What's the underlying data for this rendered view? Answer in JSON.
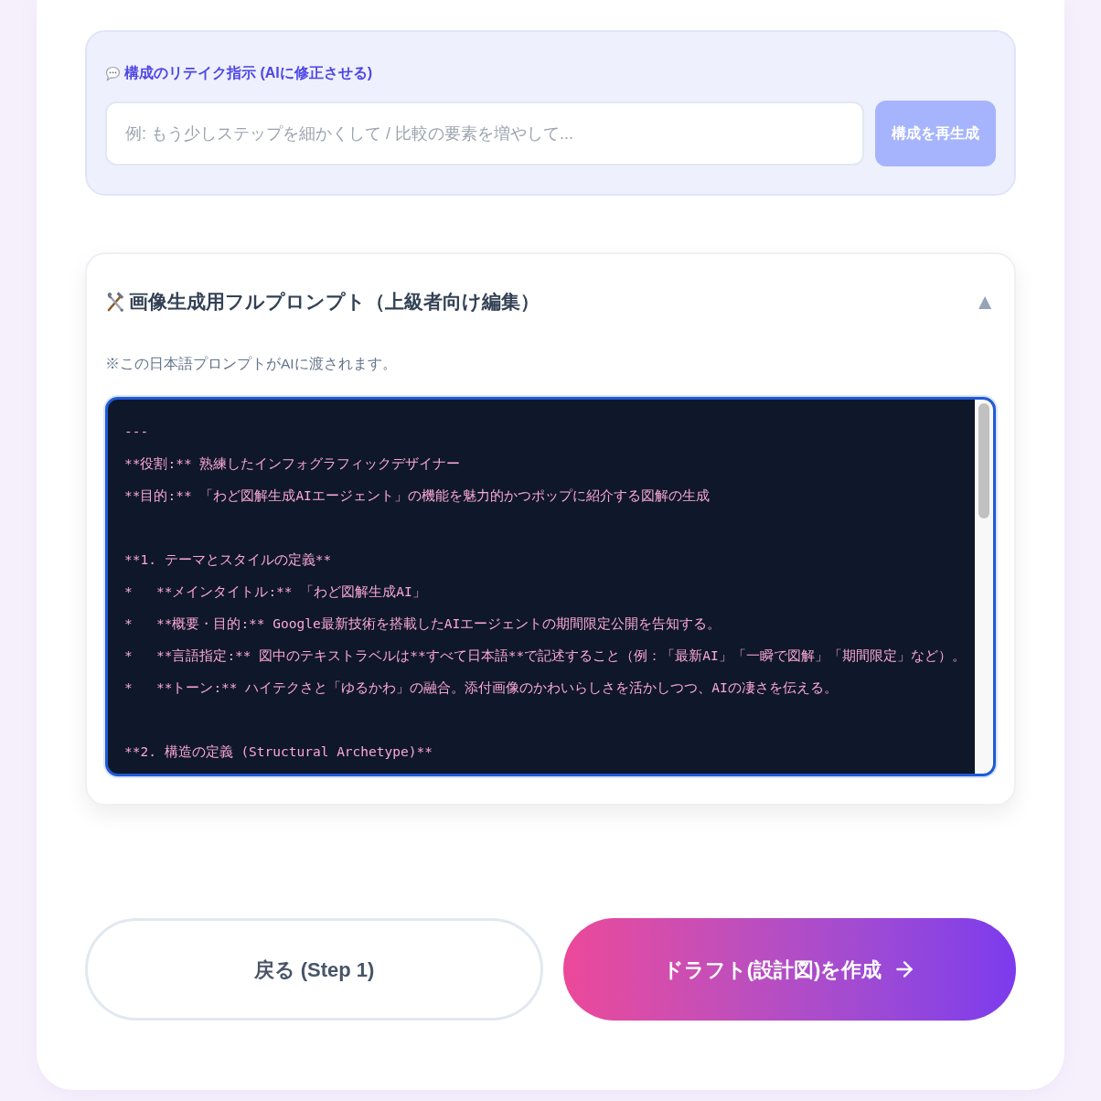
{
  "retake": {
    "label": "構成のリテイク指示 (AIに修正させる)",
    "input": {
      "placeholder": "例: もう少しステップを細かくして / 比較の要素を増やして..."
    },
    "button": {
      "label": "構成を再生成",
      "disabled": true
    }
  },
  "prompt_panel": {
    "title": "画像生成用フルプロンプト（上級者向け編集）",
    "toggle": "▲",
    "expanded": true,
    "note": "※この日本語プロンプトがAIに渡されます。",
    "editor": {
      "focused": true,
      "value": "---\n**役割:** 熟練したインフォグラフィックデザイナー\n**目的:** 「わど図解生成AIエージェント」の機能を魅力的かつポップに紹介する図解の生成\n\n**1. テーマとスタイルの定義**\n*   **メインタイトル:** 「わど図解生成AI」\n*   **概要・目的:** Google最新技術を搭載したAIエージェントの期間限定公開を告知する。\n*   **言語指定:** 図中のテキストラベルは**すべて日本語**で記述すること（例：「最新AI」「一瞬で図解」「期間限定」など）。\n*   **トーン:** ハイテクさと「ゆるかわ」の融合。添付画像のかわいらしさを活かしつつ、AIの凄さを伝える。\n\n**2. 構造の定義 (Structural Archetype)**"
    }
  },
  "footer": {
    "back_button": {
      "label": "戻る (Step 1)"
    },
    "next_button": {
      "label": "ドラフト(設計図)を作成"
    }
  }
}
